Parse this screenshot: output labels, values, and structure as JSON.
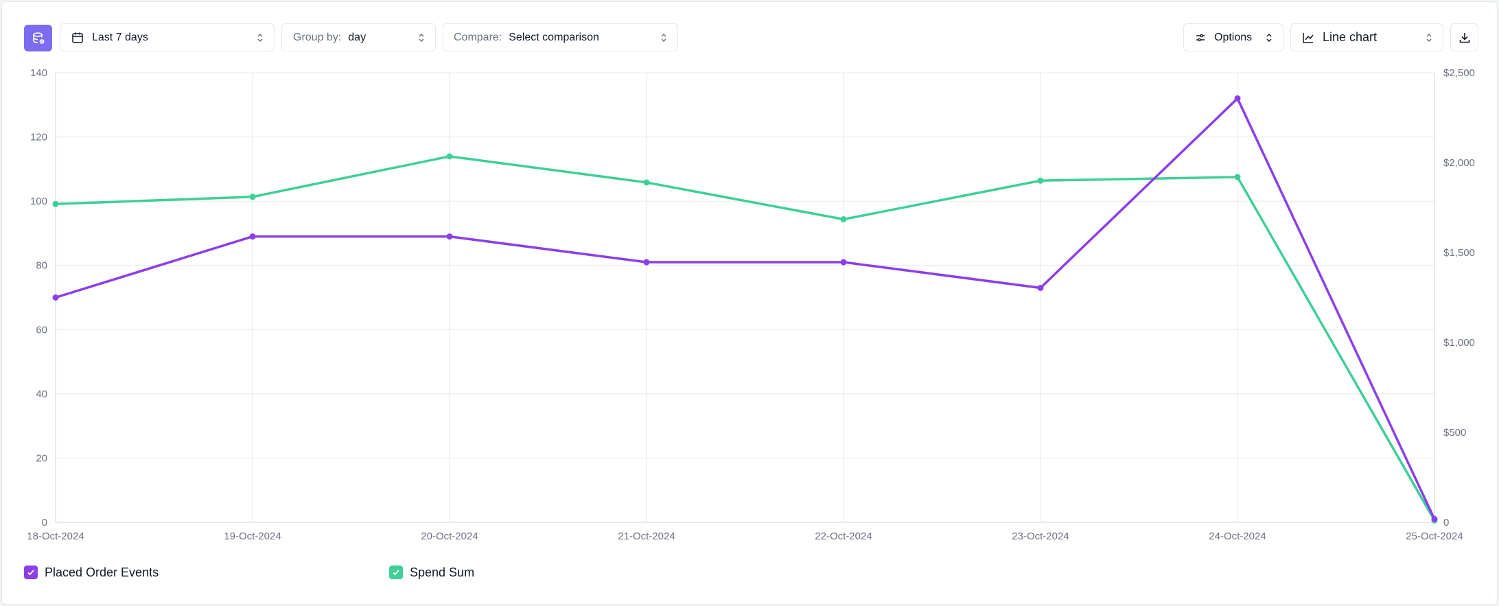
{
  "toolbar": {
    "date_range": "Last 7 days",
    "group_by_label": "Group by:",
    "group_by_value": "day",
    "compare_label": "Compare:",
    "compare_value": "Select comparison",
    "options_label": "Options",
    "chart_type_label": "Line chart"
  },
  "colors": {
    "accent": "#7c6cf0",
    "purple": "#8b3fe6",
    "green": "#3ecf97",
    "grid": "#e5e7eb"
  },
  "chart_data": {
    "type": "line",
    "x": [
      "18-Oct-2024",
      "19-Oct-2024",
      "20-Oct-2024",
      "21-Oct-2024",
      "22-Oct-2024",
      "23-Oct-2024",
      "24-Oct-2024",
      "25-Oct-2024"
    ],
    "series": [
      {
        "name": "Placed Order Events",
        "axis": "left",
        "color": "#8b3fe6",
        "values": [
          70,
          89,
          89,
          81,
          81,
          73,
          132,
          1
        ]
      },
      {
        "name": "Spend Sum",
        "axis": "right",
        "color": "#3ecf97",
        "values": [
          1770,
          1810,
          2035,
          1890,
          1685,
          1900,
          1920,
          10
        ]
      }
    ],
    "y_left": {
      "ticks": [
        "0",
        "20",
        "40",
        "60",
        "80",
        "100",
        "120",
        "140"
      ],
      "range": [
        0,
        140
      ]
    },
    "y_right": {
      "ticks": [
        "0",
        "$500",
        "$1,000",
        "$1,500",
        "$2,000",
        "$2,500"
      ],
      "range": [
        0,
        2500
      ]
    },
    "grid": true,
    "legend_position": "bottom-left"
  }
}
